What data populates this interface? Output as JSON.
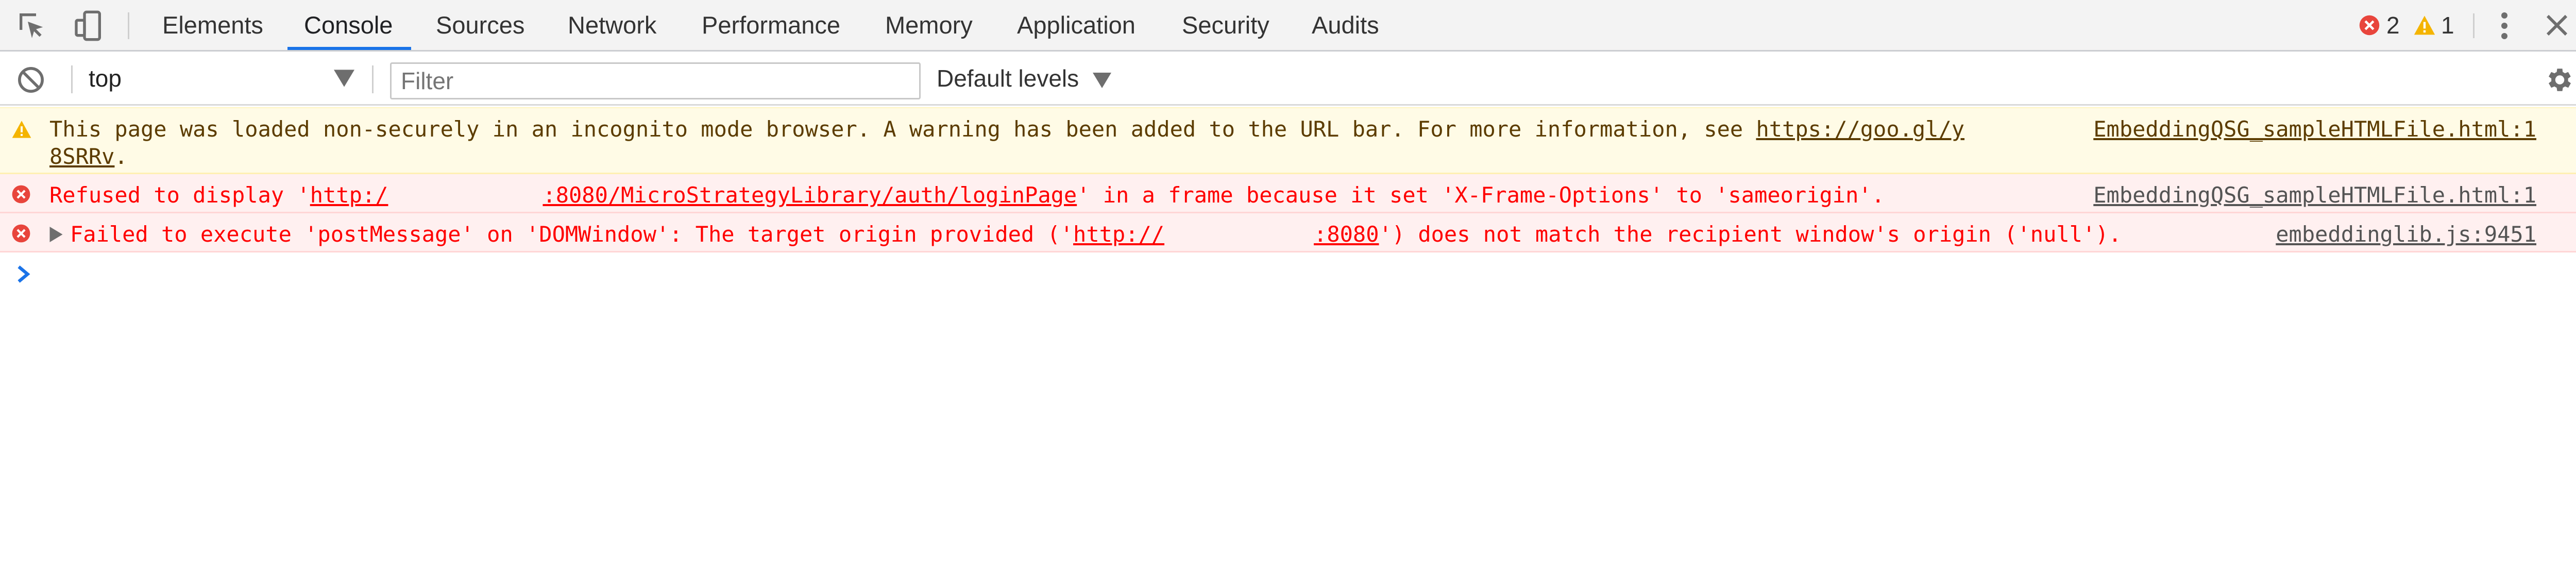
{
  "tabs": [
    "Elements",
    "Console",
    "Sources",
    "Network",
    "Performance",
    "Memory",
    "Application",
    "Security",
    "Audits"
  ],
  "active_tab": "Console",
  "counts": {
    "errors": "2",
    "warnings": "1"
  },
  "toolbar": {
    "context": "top",
    "filter_placeholder": "Filter",
    "filter_value": "",
    "levels": "Default levels"
  },
  "messages": {
    "warning": {
      "line1_text": "This page was loaded non-securely in an incognito mode browser. A warning has been added to the URL bar. For more information, see ",
      "line1_link": "https://goo.gl/y",
      "line2_link": "8SRRv",
      "line2_tail": ".",
      "source": "EmbeddingQSG_sampleHTMLFile.html:1"
    },
    "error1": {
      "pre": "Refused to display '",
      "link_a": "http:/",
      "link_b": ":8080/MicroStrategyLibrary/auth/loginPage",
      "post": "' in a frame because it set 'X-Frame-Options' to 'sameorigin'.",
      "source": "EmbeddingQSG_sampleHTMLFile.html:1"
    },
    "error2": {
      "pre": "Failed to execute 'postMessage' on 'DOMWindow': The target origin provided ('",
      "link_a": "http://",
      "link_b": ":8080",
      "post": "') does not match the recipient window's origin ('null').",
      "source": "embeddinglib.js:9451"
    }
  },
  "colors": {
    "accent": "#1a73e8",
    "error": "#ff0000",
    "warning_bg": "#fffbe6",
    "error_bg": "#fff0f0"
  }
}
